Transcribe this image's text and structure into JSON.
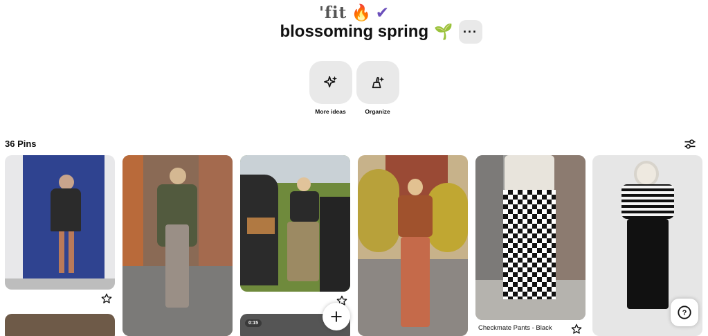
{
  "board": {
    "emoji_line_text": "'fit",
    "fire": "🔥",
    "check": "✔",
    "title": "blossoming spring",
    "sprout": "🌱",
    "more_label": "···"
  },
  "actions": [
    {
      "label": "More ideas",
      "icon": "sparkles-icon"
    },
    {
      "label": "Organize",
      "icon": "broom-icon"
    }
  ],
  "pins_header": {
    "count_label": "36 Pins",
    "filter_icon": "filter-sliders-icon"
  },
  "pins": [
    {
      "title": "",
      "has_video": false
    },
    {
      "title": "",
      "has_video": false
    },
    {
      "title": "",
      "has_video": true,
      "video_duration": "0:15"
    },
    {
      "title": "",
      "has_video": false
    },
    {
      "title": "Checkmate Pants - Black",
      "has_video": false
    },
    {
      "title": "",
      "has_video": false
    }
  ],
  "floating": {
    "add_icon": "plus-icon",
    "help_label": "?"
  },
  "colors": {
    "button_bg": "#e9e9e9",
    "accent_purple": "#6b4fbb"
  }
}
